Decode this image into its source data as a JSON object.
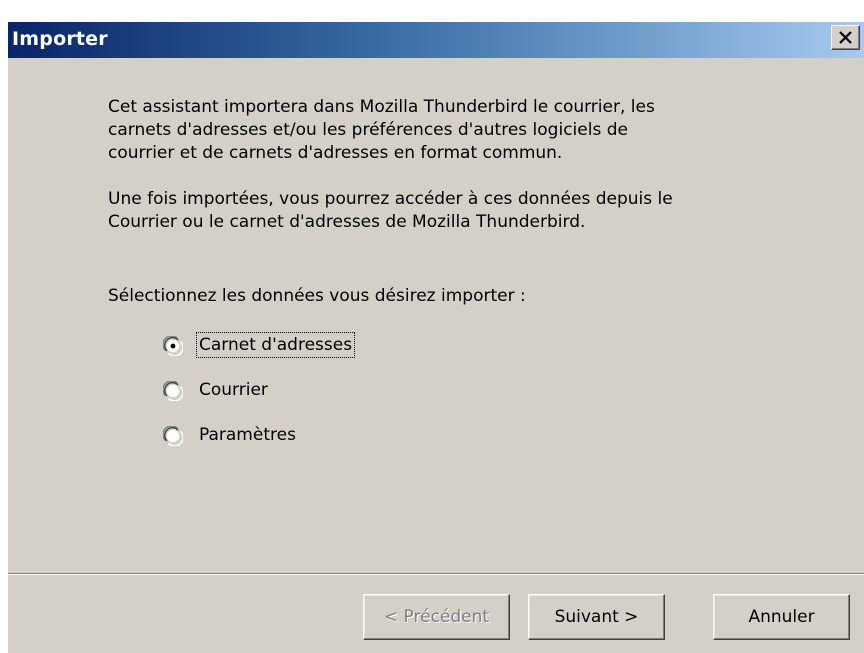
{
  "window": {
    "title": "Importer",
    "close_symbol": "×"
  },
  "intro": {
    "paragraph1": "Cet assistant importera dans Mozilla Thunderbird le courrier, les\ncarnets d'adresses et/ou les préférences d'autres logiciels de\ncourrier et de carnets d'adresses en format commun.",
    "paragraph2": "Une fois importées, vous pourrez accéder à ces données depuis le\nCourrier ou le carnet d'adresses de Mozilla Thunderbird."
  },
  "prompt": "Sélectionnez les données vous désirez importer :",
  "options": [
    {
      "label": "Carnet d'adresses",
      "selected": true
    },
    {
      "label": "Courrier",
      "selected": false
    },
    {
      "label": "Paramètres",
      "selected": false
    }
  ],
  "buttons": {
    "previous": "< Précédent",
    "next": "Suivant >",
    "cancel": "Annuler"
  },
  "colors": {
    "title_gradient_start": "#0a246a",
    "title_gradient_end": "#a6caf0",
    "dialog_bg": "#d4d0c8",
    "disabled_text": "#808080"
  },
  "icons": {
    "close": "close-icon",
    "radio": "radio-button-icon"
  }
}
